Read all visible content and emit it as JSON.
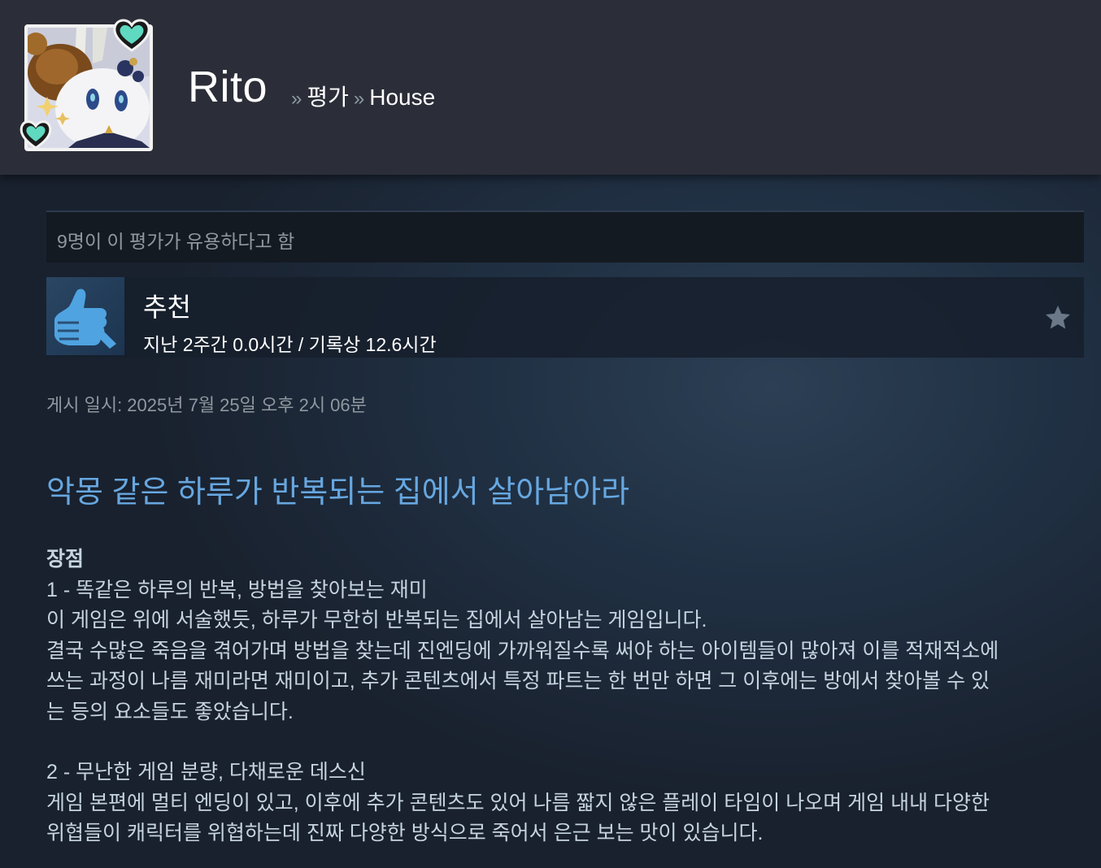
{
  "header": {
    "profile_name": "Rito",
    "crumb_sep": "»",
    "crumb_reviews": "평가",
    "crumb_game": "House"
  },
  "review": {
    "helpful_text": "9명이 이 평가가 유용하다고 함",
    "recommendation": "추천",
    "hours": "지난 2주간 0.0시간 / 기록상 12.6시간",
    "posted": "게시 일시: 2025년 7월 25일 오후 2시 06분",
    "title": "악몽 같은 하루가 반복되는 집에서 살아남아라",
    "section_pros": "장점",
    "point1_title": "1 - 똑같은 하루의 반복, 방법을 찾아보는 재미",
    "point1_line1": "이 게임은 위에 서술했듯, 하루가 무한히 반복되는 집에서 살아남는 게임입니다.",
    "point1_line2": "결국 수많은 죽음을 겪어가며 방법을 찾는데 진엔딩에 가까워질수록 써야 하는 아이템들이 많아져 이를 적재적소에",
    "point1_line3": "쓰는 과정이 나름 재미라면 재미이고, 추가 콘텐츠에서 특정 파트는 한 번만 하면 그 이후에는 방에서 찾아볼 수 있",
    "point1_line4": "는 등의 요소들도 좋았습니다.",
    "point2_title": "2 - 무난한 게임 분량, 다채로운 데스신",
    "point2_line1": "게임 본편에 멀티 엔딩이 있고, 이후에 추가 콘텐츠도 있어 나름 짧지 않은 플레이 타임이 나오며 게임 내내 다양한",
    "point2_line2": "위협들이 캐릭터를 위협하는데 진짜 다양한 방식으로 죽어서 은근 보는 맛이 있습니다."
  },
  "colors": {
    "header_bg": "#2b2e38",
    "title_blue": "#67a7e0",
    "thumb_blue": "#4fa3e0",
    "heart_teal": "#5fd9c0"
  },
  "icons": {
    "avatar": "avatar-bunny-icon",
    "thumb": "thumbs-up-icon",
    "star": "star-icon",
    "hearts": "heart-icon"
  }
}
